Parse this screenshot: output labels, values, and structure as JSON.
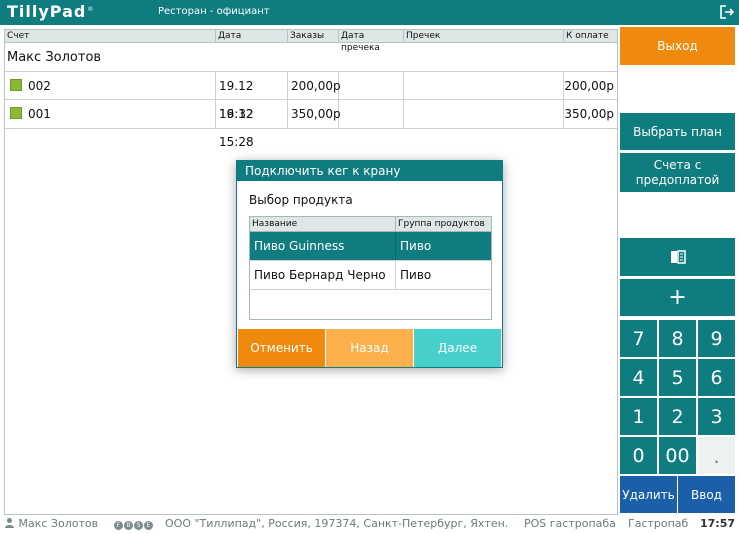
{
  "header": {
    "logo": "TillyPad",
    "logo_mark": "®",
    "title": "Ресторан - официант"
  },
  "table": {
    "columns": [
      "Счет",
      "Дата",
      "Заказы",
      "Дата пречека",
      "Пречек",
      "К оплате"
    ],
    "group": "Макс Золотов",
    "rows": [
      {
        "account": "002",
        "date": "19.12 16:32",
        "orders": "200,00р",
        "precheck_date": "",
        "precheck": "",
        "to_pay": "200,00р",
        "status_color": "#8db63a"
      },
      {
        "account": "001",
        "date": "19.12 15:28",
        "orders": "350,00р",
        "precheck_date": "",
        "precheck": "",
        "to_pay": "350,00р",
        "status_color": "#8db63a"
      }
    ]
  },
  "sidebar": {
    "exit": "Выход",
    "choose_plan": "Выбрать план",
    "prepaid_accounts": "Счета с предоплатой",
    "plus": "+",
    "keys": [
      "7",
      "8",
      "9",
      "4",
      "5",
      "6",
      "1",
      "2",
      "3",
      "0",
      "00",
      "."
    ],
    "delete": "Удалить",
    "enter": "Ввод"
  },
  "dialog": {
    "title": "Подключить кег к крану",
    "label": "Выбор продукта",
    "columns": [
      "Название",
      "Группа продуктов"
    ],
    "products": [
      {
        "name": "Пиво Guinness Draught",
        "group": "Пиво",
        "selected": true
      },
      {
        "name": "Пиво Бернард Черно",
        "group": "Пиво",
        "selected": false
      }
    ],
    "cancel": "Отменить",
    "back": "Назад",
    "next": "Далее"
  },
  "status": {
    "user": "Макс Золотов",
    "flags": [
      "F",
      "B",
      "S",
      "E"
    ],
    "company": "ООО \"Тиллипад\", Россия, 197374, Санкт-Петербург, Яхтен...",
    "pos": "POS гастропаба",
    "venue": "Гастропаб",
    "time": "17:57"
  },
  "colors": {
    "accent": "#0f7c80",
    "orange": "#f08a0e",
    "navy": "#1a5fa8",
    "status_green": "#8db63a"
  }
}
